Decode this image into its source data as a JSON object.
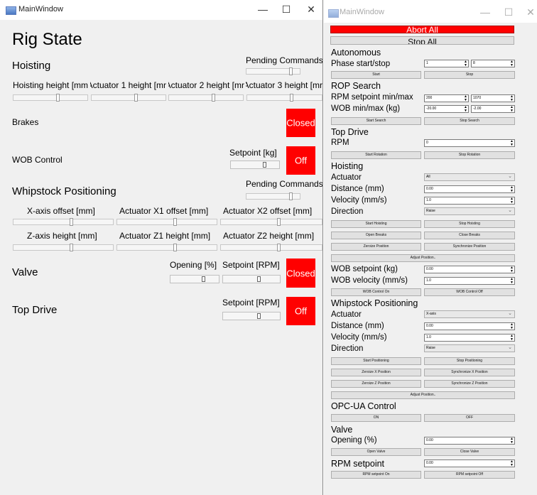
{
  "left_window": {
    "title": "MainWindow",
    "heading": "Rig State",
    "hoisting": {
      "title": "Hoisting",
      "pending_label": "Pending Commands",
      "columns": [
        "Hoisting height [mm",
        "Actuator 1 height [mr",
        "Actuator 2 height [mr",
        "Actuator 3 height [mr"
      ]
    },
    "brakes": {
      "label": "Brakes",
      "state": "Closed"
    },
    "wob_control": {
      "label": "WOB Control",
      "setpoint_label": "Setpoint [kg]",
      "state": "Off"
    },
    "whipstock": {
      "title": "Whipstock Positioning",
      "pending_label": "Pending Commands",
      "row1": [
        "X-axis offset [mm]",
        "Actuator X1 offset [mm]",
        "Actuator X2 offset [mm]"
      ],
      "row2": [
        "Z-axis height [mm]",
        "Actuator Z1 height [mm]",
        "Actuator Z2 height [mm]"
      ]
    },
    "valve": {
      "label": "Valve",
      "opening_label": "Opening [%]",
      "setpoint_label": "Setpoint [RPM]",
      "state": "Closed"
    },
    "top_drive": {
      "label": "Top Drive",
      "setpoint_label": "Setpoint [RPM]",
      "state": "Off"
    }
  },
  "right_window": {
    "title": "MainWindow",
    "abort_all": "Abort All",
    "stop_all": "Stop All",
    "autonomous": {
      "title": "Autonomous",
      "phase_label": "Phase start/stop",
      "phase_start": "1",
      "phase_stop": "8",
      "start": "Start",
      "stop": "Stop"
    },
    "rop_search": {
      "title": "ROP Search",
      "rpm_label": "RPM setpoint min/max",
      "rpm_min": "200",
      "rpm_max": "1070",
      "wob_label": "WOB min/max (kg)",
      "wob_min": "-20.00",
      "wob_max": "-2.00",
      "start": "Start Search",
      "stop": "Stop Search"
    },
    "top_drive": {
      "title": "Top Drive",
      "rpm_label": "RPM",
      "rpm_value": "0",
      "start": "Start Rotation",
      "stop": "Stop Rotation"
    },
    "hoisting": {
      "title": "Hoisting",
      "actuator_label": "Actuator",
      "actuator_value": "All",
      "distance_label": "Distance (mm)",
      "distance_value": "0.00",
      "velocity_label": "Velocity (mm/s)",
      "velocity_value": "1.0",
      "direction_label": "Direction",
      "direction_value": "Raise",
      "start": "Start Hoisting",
      "stop": "Stop Hoisting",
      "open_brakes": "Open Breaks",
      "close_brakes": "Close Breaks",
      "zeroize": "Zeroize Position",
      "synchronize": "Synchronize Position",
      "adjust": "Adjust Position..",
      "wob_setpoint_label": "WOB setpoint (kg)",
      "wob_setpoint_value": "0.00",
      "wob_velocity_label": "WOB velocity (mm/s)",
      "wob_velocity_value": "1.0",
      "wob_on": "WOB Control On",
      "wob_off": "WOB Control Off"
    },
    "whipstock": {
      "title": "Whipstock Positioning",
      "actuator_label": "Actuator",
      "actuator_value": "X-axis",
      "distance_label": "Distance (mm)",
      "distance_value": "0.00",
      "velocity_label": "Velocity (mm/s)",
      "velocity_value": "1.0",
      "direction_label": "Direction",
      "direction_value": "Raise",
      "start": "Start Positioning",
      "stop": "Stop Positioning",
      "zeroize_x": "Zeroize X Position",
      "sync_x": "Synchronize X Position",
      "zeroize_z": "Zeroize Z Position",
      "sync_z": "Synchronize Z Position",
      "adjust": "Adjust Position.."
    },
    "opc": {
      "title": "OPC-UA Control",
      "on": "ON",
      "off": "OFF"
    },
    "valve": {
      "title": "Valve",
      "opening_label": "Opening (%)",
      "opening_value": "0.00",
      "open": "Open Valve",
      "close": "Close Valve"
    },
    "rpm": {
      "title": "RPM setpoint",
      "value": "0.00",
      "on": "RPM setpoint On",
      "off": "RPM setpoint Off"
    }
  },
  "colors": {
    "red": "#ff0000",
    "background": "#f0f0f0"
  }
}
